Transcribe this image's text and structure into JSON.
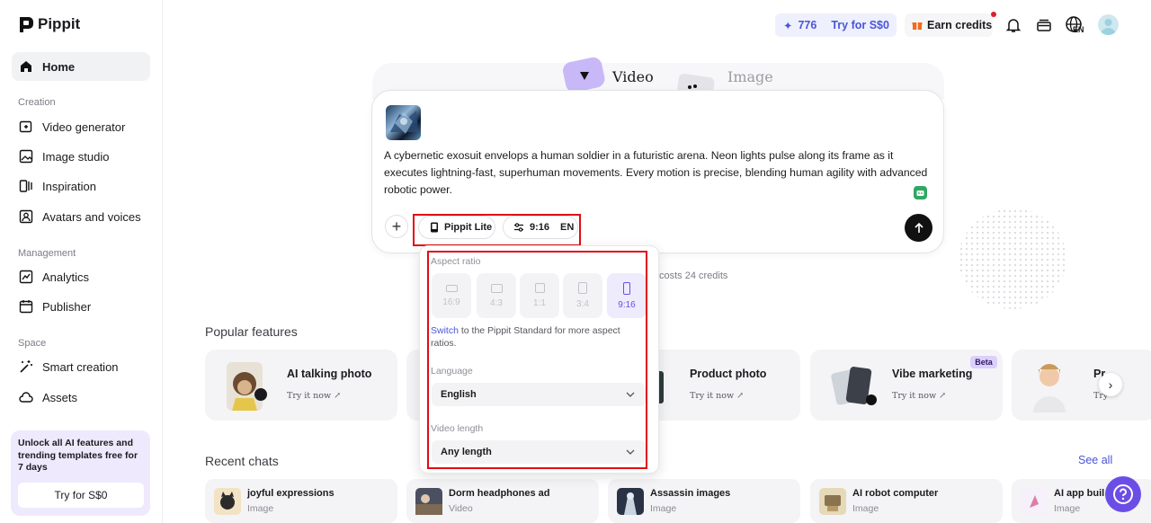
{
  "brand": {
    "name": "Pippit"
  },
  "sidebar": {
    "home": "Home",
    "sections": {
      "creation": "Creation",
      "management": "Management",
      "space": "Space"
    },
    "creation_items": [
      "Video generator",
      "Image studio",
      "Inspiration",
      "Avatars and voices"
    ],
    "management_items": [
      "Analytics",
      "Publisher"
    ],
    "space_items": [
      "Smart creation",
      "Assets"
    ],
    "promo": {
      "text": "Unlock all AI features and trending templates free for 7 days",
      "button": "Try for S$0"
    }
  },
  "topbar": {
    "credits": "776",
    "try_label": "Try for S$0",
    "earn_label": "Earn credits",
    "lang": "EN"
  },
  "mode_tabs": {
    "video": "Video",
    "image": "Image"
  },
  "prompt": {
    "text": "A cybernetic exosuit envelops a human soldier in a futuristic arena. Neon lights pulse along its frame as it executes lightning-fast, superhuman movements. Every motion is precise, blending human agility with advanced robotic power.",
    "model_label": "Pippit Lite",
    "ratio_label": "9:16",
    "lang_label": "EN",
    "cost_text": "costs 24 credits"
  },
  "popup": {
    "aspect_label": "Aspect ratio",
    "ratios": [
      "16:9",
      "4:3",
      "1:1",
      "3:4",
      "9:16"
    ],
    "selected_ratio": "9:16",
    "switch_link": "Switch",
    "switch_rest": " to the Pippit Standard for more aspect ratios.",
    "language_label": "Language",
    "language_value": "English",
    "length_label": "Video length",
    "length_value": "Any length"
  },
  "popular": {
    "title": "Popular features",
    "items": [
      {
        "title": "AI talking photo",
        "sub": "Try it now ↗"
      },
      {
        "title": "Product photo",
        "sub": "Try it now ↗"
      },
      {
        "title": "Vibe marketing",
        "sub": "Try it now ↗",
        "badge": "Beta"
      },
      {
        "title": "Pr",
        "sub": "Try"
      }
    ]
  },
  "recent": {
    "title": "Recent chats",
    "see_all": "See all",
    "items": [
      {
        "title": "joyful expressions",
        "type": "Image"
      },
      {
        "title": "Dorm headphones ad",
        "type": "Video"
      },
      {
        "title": "Assassin images",
        "type": "Image"
      },
      {
        "title": "AI robot computer",
        "type": "Image"
      },
      {
        "title": "AI app buil",
        "type": "Image"
      }
    ]
  },
  "colors": {
    "accent": "#4b54d8",
    "purple": "#6b4ee6",
    "highlight_red": "#e10b14"
  }
}
